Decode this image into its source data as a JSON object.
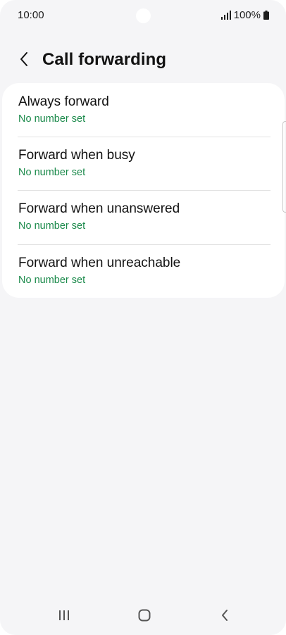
{
  "status_bar": {
    "time": "10:00",
    "battery": "100%",
    "icons": [
      "signal-icon",
      "battery-icon"
    ]
  },
  "header": {
    "title": "Call forwarding",
    "back_icon": "chevron-left-icon"
  },
  "forwarding_options": [
    {
      "title": "Always forward",
      "subtitle": "No number set"
    },
    {
      "title": "Forward when busy",
      "subtitle": "No number set"
    },
    {
      "title": "Forward when unanswered",
      "subtitle": "No number set"
    },
    {
      "title": "Forward when unreachable",
      "subtitle": "No number set"
    }
  ],
  "nav_bar": {
    "icons": [
      "recent-apps-icon",
      "home-icon",
      "back-icon"
    ]
  },
  "colors": {
    "background": "#f5f5f7",
    "card": "#ffffff",
    "accent_green": "#1b8a4b",
    "text": "#111111"
  }
}
